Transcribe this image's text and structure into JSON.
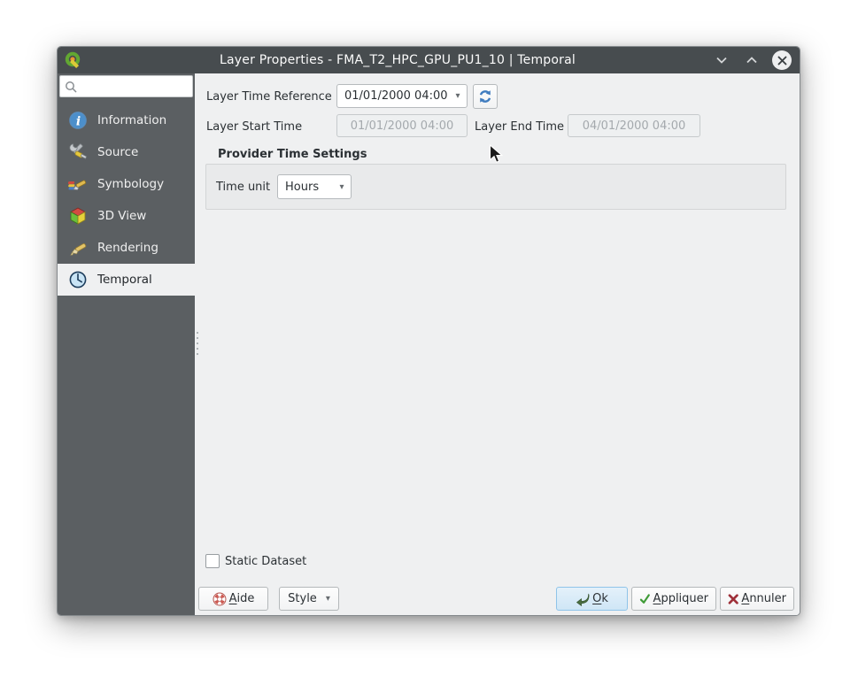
{
  "window": {
    "title": "Layer Properties - FMA_T2_HPC_GPU_PU1_10 | Temporal"
  },
  "icons": {
    "combo_arrow": "▾"
  },
  "sidebar": {
    "search": {
      "placeholder": "",
      "value": ""
    },
    "items": [
      {
        "label": "Information",
        "icon": "information-icon",
        "selected": false
      },
      {
        "label": "Source",
        "icon": "source-icon",
        "selected": false
      },
      {
        "label": "Symbology",
        "icon": "symbology-icon",
        "selected": false
      },
      {
        "label": "3D View",
        "icon": "3d-view-icon",
        "selected": false
      },
      {
        "label": "Rendering",
        "icon": "rendering-icon",
        "selected": false
      },
      {
        "label": "Temporal",
        "icon": "temporal-icon",
        "selected": true
      }
    ]
  },
  "main": {
    "layer_time_reference_label": "Layer Time Reference",
    "layer_time_reference_value": "01/01/2000 04:00",
    "layer_start_time_label": "Layer Start Time",
    "layer_start_time_value": "01/01/2000 04:00",
    "layer_end_time_label": "Layer End Time",
    "layer_end_time_value": "04/01/2000 04:00",
    "provider_settings_title": "Provider Time Settings",
    "time_unit_label": "Time unit",
    "time_unit_value": "Hours",
    "static_dataset_label": "Static Dataset",
    "static_dataset_checked": false
  },
  "footer": {
    "help": {
      "underline": "A",
      "rest": "ide"
    },
    "style_label": "Style",
    "ok": {
      "underline": "O",
      "rest": "k"
    },
    "apply": {
      "underline": "A",
      "rest": "ppliquer"
    },
    "cancel": {
      "underline": "A",
      "rest": "nnuler"
    }
  },
  "colors": {
    "titlebar": "#474c4f",
    "sidebar": "#5b5f62",
    "panel": "#eff0f1",
    "default_button_bg": "#d7eaf8",
    "default_button_border": "#8fc4e9"
  }
}
